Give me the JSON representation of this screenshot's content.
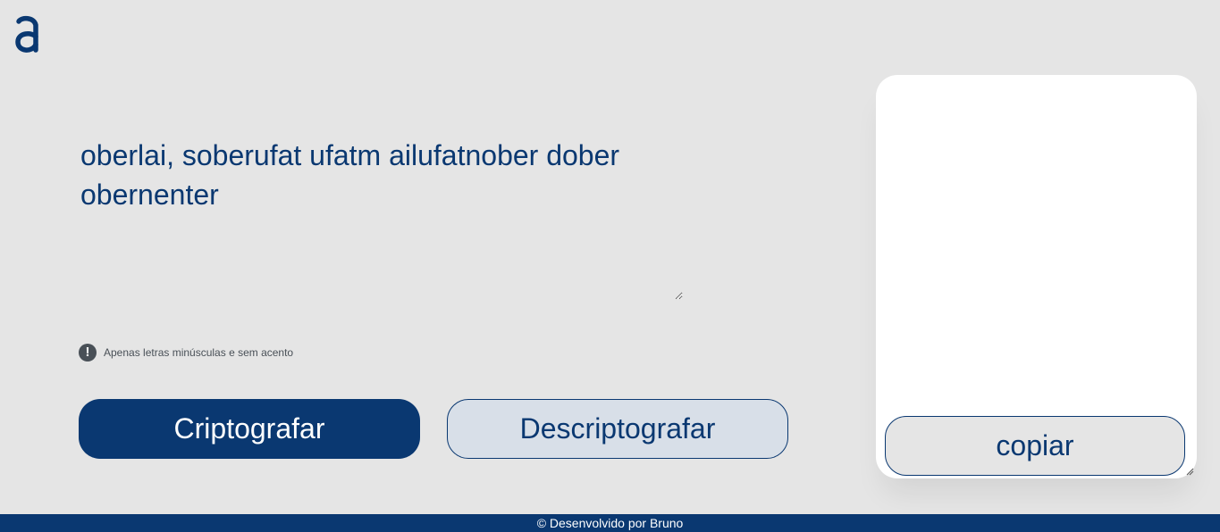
{
  "header": {
    "logo_icon": "alura-logo-icon"
  },
  "main": {
    "input_text": "oberlai, soberufat ufatm ailufatnober dober obernenter",
    "hint_icon": "exclamation-circle-icon",
    "hint_text": "Apenas letras minúsculas e sem acento",
    "encrypt_label": "Criptografar",
    "decrypt_label": "Descriptografar"
  },
  "output": {
    "text": "",
    "copy_label": "copiar"
  },
  "footer": {
    "text": "© Desenvolvido por Bruno"
  },
  "colors": {
    "primary": "#0a3871",
    "background": "#e5e5e5",
    "panel": "#ffffff",
    "secondary_button": "#d8dfe8",
    "hint": "#495057"
  }
}
